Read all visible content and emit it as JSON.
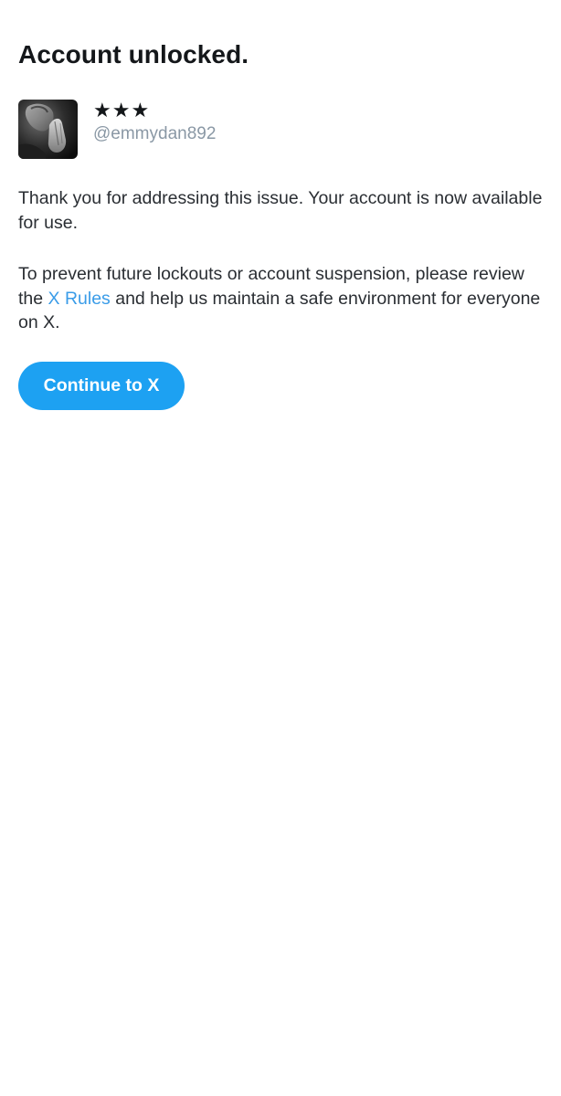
{
  "header": {
    "title": "Account unlocked."
  },
  "profile": {
    "display_name": "★★★",
    "handle": "@emmydan892",
    "avatar_icon": "praying-hands-photo"
  },
  "message": {
    "paragraph1": "Thank you for addressing this issue. Your account is now available for use.",
    "paragraph2_before": "To prevent future lockouts or account suspension, please review the ",
    "paragraph2_link": "X Rules",
    "paragraph2_after": " and help us maintain a safe environment for everyone on X."
  },
  "actions": {
    "continue_label": "Continue to X"
  },
  "colors": {
    "accent": "#1da1f2",
    "link": "#3a9ce8",
    "handle": "#8a98a5",
    "text": "#14171a"
  }
}
